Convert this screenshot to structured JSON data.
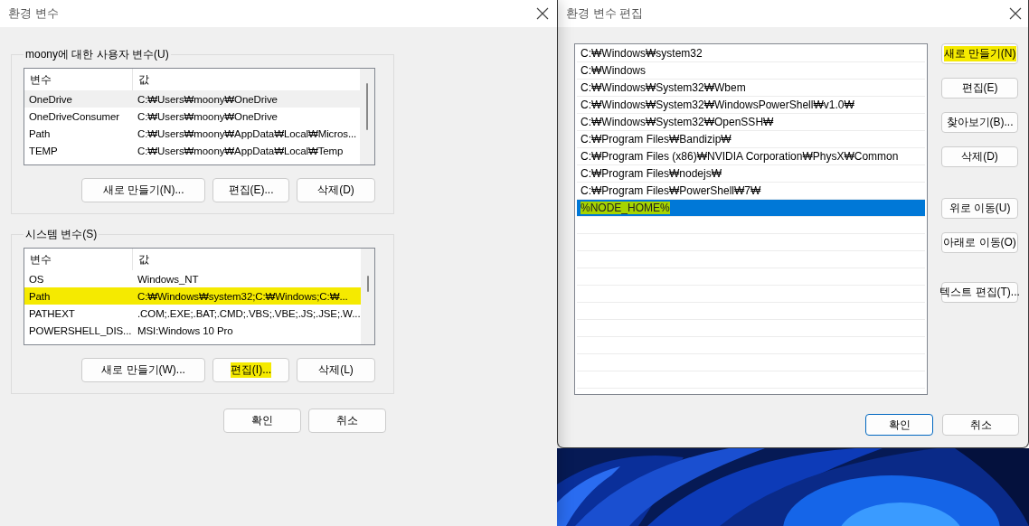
{
  "env_dialog": {
    "title": "환경 변수",
    "user_vars": {
      "label": "moony에 대한 사용자 변수(U)",
      "columns": [
        "변수",
        "값"
      ],
      "rows": [
        {
          "name": "OneDrive",
          "value": "C:₩Users₩moony₩OneDrive",
          "selected": true,
          "highlighted": false
        },
        {
          "name": "OneDriveConsumer",
          "value": "C:₩Users₩moony₩OneDrive",
          "selected": false,
          "highlighted": false
        },
        {
          "name": "Path",
          "value": "C:₩Users₩moony₩AppData₩Local₩Micros...",
          "selected": false,
          "highlighted": false
        },
        {
          "name": "TEMP",
          "value": "C:₩Users₩moony₩AppData₩Local₩Temp",
          "selected": false,
          "highlighted": false
        }
      ],
      "buttons": [
        {
          "label": "새로 만들기(N)...",
          "highlighted": false
        },
        {
          "label": "편집(E)...",
          "highlighted": false
        },
        {
          "label": "삭제(D)",
          "highlighted": false
        }
      ]
    },
    "system_vars": {
      "label": "시스템 변수(S)",
      "columns": [
        "변수",
        "값"
      ],
      "rows": [
        {
          "name": "OS",
          "value": "Windows_NT",
          "selected": false,
          "highlighted": false
        },
        {
          "name": "Path",
          "value": "C:₩Windows₩system32;C:₩Windows;C:₩...",
          "selected": false,
          "highlighted": true
        },
        {
          "name": "PATHEXT",
          "value": ".COM;.EXE;.BAT;.CMD;.VBS;.VBE;.JS;.JSE;.W...",
          "selected": false,
          "highlighted": false
        },
        {
          "name": "POWERSHELL_DIS...",
          "value": "MSI:Windows 10 Pro",
          "selected": false,
          "highlighted": false
        }
      ],
      "buttons": [
        {
          "label": "새로 만들기(W)...",
          "highlighted": false
        },
        {
          "label": "편집(I)...",
          "highlighted": true
        },
        {
          "label": "삭제(L)",
          "highlighted": false
        }
      ]
    },
    "buttons": [
      {
        "label": "확인",
        "default": false
      },
      {
        "label": "취소",
        "default": false
      }
    ]
  },
  "edit_dialog": {
    "title": "환경 변수 편집",
    "entries": [
      {
        "text": "C:₩Windows₩system32",
        "selected": false,
        "highlighted": false
      },
      {
        "text": "C:₩Windows",
        "selected": false,
        "highlighted": false
      },
      {
        "text": "C:₩Windows₩System32₩Wbem",
        "selected": false,
        "highlighted": false
      },
      {
        "text": "C:₩Windows₩System32₩WindowsPowerShell₩v1.0₩",
        "selected": false,
        "highlighted": false
      },
      {
        "text": "C:₩Windows₩System32₩OpenSSH₩",
        "selected": false,
        "highlighted": false
      },
      {
        "text": "C:₩Program Files₩Bandizip₩",
        "selected": false,
        "highlighted": false
      },
      {
        "text": "C:₩Program Files (x86)₩NVIDIA Corporation₩PhysX₩Common",
        "selected": false,
        "highlighted": false
      },
      {
        "text": "C:₩Program Files₩nodejs₩",
        "selected": false,
        "highlighted": false
      },
      {
        "text": "C:₩Program Files₩PowerShell₩7₩",
        "selected": false,
        "highlighted": false
      },
      {
        "text": "%NODE_HOME%",
        "selected": true,
        "highlighted": true
      }
    ],
    "side_button_groups": [
      [
        {
          "label": "새로 만들기(N)",
          "highlighted": true
        },
        {
          "label": "편집(E)",
          "highlighted": false
        },
        {
          "label": "찾아보기(B)...",
          "highlighted": false
        },
        {
          "label": "삭제(D)",
          "highlighted": false
        }
      ],
      [
        {
          "label": "위로 이동(U)",
          "highlighted": false
        },
        {
          "label": "아래로 이동(O)",
          "highlighted": false
        }
      ],
      [
        {
          "label": "텍스트 편집(T)...",
          "highlighted": false
        }
      ]
    ],
    "buttons": [
      {
        "label": "확인",
        "default": true
      },
      {
        "label": "취소",
        "default": false
      }
    ]
  }
}
